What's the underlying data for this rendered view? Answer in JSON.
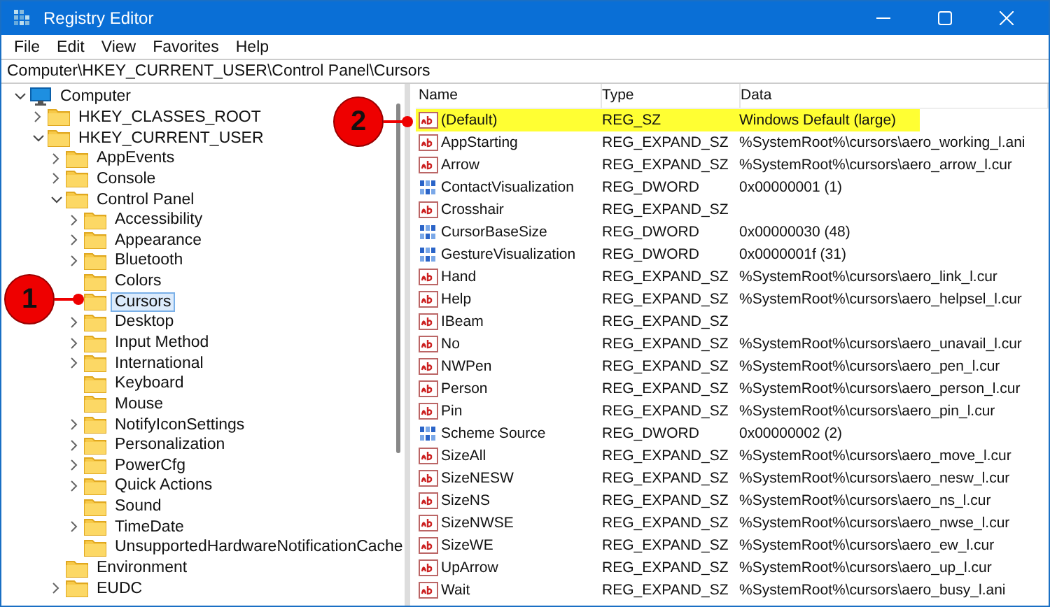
{
  "window": {
    "title": "Registry Editor"
  },
  "menu": [
    "File",
    "Edit",
    "View",
    "Favorites",
    "Help"
  ],
  "address": "Computer\\HKEY_CURRENT_USER\\Control Panel\\Cursors",
  "tree": [
    {
      "label": "Computer",
      "kind": "computer",
      "expanded": true,
      "selected": false,
      "children": [
        {
          "label": "HKEY_CLASSES_ROOT",
          "expanded": false,
          "selected": false
        },
        {
          "label": "HKEY_CURRENT_USER",
          "expanded": true,
          "selected": false,
          "children": [
            {
              "label": "AppEvents",
              "expanded": false,
              "selected": false
            },
            {
              "label": "Console",
              "expanded": false,
              "selected": false
            },
            {
              "label": "Control Panel",
              "expanded": true,
              "selected": false,
              "children": [
                {
                  "label": "Accessibility",
                  "expanded": false,
                  "selected": false
                },
                {
                  "label": "Appearance",
                  "expanded": false,
                  "selected": false
                },
                {
                  "label": "Bluetooth",
                  "expanded": false,
                  "selected": false
                },
                {
                  "label": "Colors",
                  "selected": false
                },
                {
                  "label": "Cursors",
                  "selected": true
                },
                {
                  "label": "Desktop",
                  "expanded": false,
                  "selected": false
                },
                {
                  "label": "Input Method",
                  "expanded": false,
                  "selected": false
                },
                {
                  "label": "International",
                  "expanded": false,
                  "selected": false
                },
                {
                  "label": "Keyboard",
                  "selected": false
                },
                {
                  "label": "Mouse",
                  "selected": false
                },
                {
                  "label": "NotifyIconSettings",
                  "expanded": false,
                  "selected": false
                },
                {
                  "label": "Personalization",
                  "expanded": false,
                  "selected": false
                },
                {
                  "label": "PowerCfg",
                  "expanded": false,
                  "selected": false
                },
                {
                  "label": "Quick Actions",
                  "expanded": false,
                  "selected": false
                },
                {
                  "label": "Sound",
                  "selected": false
                },
                {
                  "label": "TimeDate",
                  "expanded": false,
                  "selected": false
                },
                {
                  "label": "UnsupportedHardwareNotificationCache",
                  "selected": false
                }
              ]
            },
            {
              "label": "Environment",
              "selected": false
            },
            {
              "label": "EUDC",
              "expanded": false,
              "selected": false
            }
          ]
        }
      ]
    }
  ],
  "table": {
    "columns": [
      "Name",
      "Type",
      "Data"
    ],
    "rows": [
      {
        "kind": "string",
        "name": "(Default)",
        "type": "REG_SZ",
        "data": "Windows Default (large)",
        "highlighted": true
      },
      {
        "kind": "string",
        "name": "AppStarting",
        "type": "REG_EXPAND_SZ",
        "data": "%SystemRoot%\\cursors\\aero_working_l.ani",
        "highlighted": false
      },
      {
        "kind": "string",
        "name": "Arrow",
        "type": "REG_EXPAND_SZ",
        "data": "%SystemRoot%\\cursors\\aero_arrow_l.cur",
        "highlighted": false
      },
      {
        "kind": "dword",
        "name": "ContactVisualization",
        "type": "REG_DWORD",
        "data": "0x00000001 (1)",
        "highlighted": false
      },
      {
        "kind": "string",
        "name": "Crosshair",
        "type": "REG_EXPAND_SZ",
        "highlighted": false
      },
      {
        "kind": "dword",
        "name": "CursorBaseSize",
        "type": "REG_DWORD",
        "data": "0x00000030 (48)",
        "highlighted": false
      },
      {
        "kind": "dword",
        "name": "GestureVisualization",
        "type": "REG_DWORD",
        "data": "0x0000001f (31)",
        "highlighted": false
      },
      {
        "kind": "string",
        "name": "Hand",
        "type": "REG_EXPAND_SZ",
        "data": "%SystemRoot%\\cursors\\aero_link_l.cur",
        "highlighted": false
      },
      {
        "kind": "string",
        "name": "Help",
        "type": "REG_EXPAND_SZ",
        "data": "%SystemRoot%\\cursors\\aero_helpsel_l.cur",
        "highlighted": false
      },
      {
        "kind": "string",
        "name": "IBeam",
        "type": "REG_EXPAND_SZ",
        "highlighted": false
      },
      {
        "kind": "string",
        "name": "No",
        "type": "REG_EXPAND_SZ",
        "data": "%SystemRoot%\\cursors\\aero_unavail_l.cur",
        "highlighted": false
      },
      {
        "kind": "string",
        "name": "NWPen",
        "type": "REG_EXPAND_SZ",
        "data": "%SystemRoot%\\cursors\\aero_pen_l.cur",
        "highlighted": false
      },
      {
        "kind": "string",
        "name": "Person",
        "type": "REG_EXPAND_SZ",
        "data": "%SystemRoot%\\cursors\\aero_person_l.cur",
        "highlighted": false
      },
      {
        "kind": "string",
        "name": "Pin",
        "type": "REG_EXPAND_SZ",
        "data": "%SystemRoot%\\cursors\\aero_pin_l.cur",
        "highlighted": false
      },
      {
        "kind": "dword",
        "name": "Scheme Source",
        "type": "REG_DWORD",
        "data": "0x00000002 (2)",
        "highlighted": false
      },
      {
        "kind": "string",
        "name": "SizeAll",
        "type": "REG_EXPAND_SZ",
        "data": "%SystemRoot%\\cursors\\aero_move_l.cur",
        "highlighted": false
      },
      {
        "kind": "string",
        "name": "SizeNESW",
        "type": "REG_EXPAND_SZ",
        "data": "%SystemRoot%\\cursors\\aero_nesw_l.cur",
        "highlighted": false
      },
      {
        "kind": "string",
        "name": "SizeNS",
        "type": "REG_EXPAND_SZ",
        "data": "%SystemRoot%\\cursors\\aero_ns_l.cur",
        "highlighted": false
      },
      {
        "kind": "string",
        "name": "SizeNWSE",
        "type": "REG_EXPAND_SZ",
        "data": "%SystemRoot%\\cursors\\aero_nwse_l.cur",
        "highlighted": false
      },
      {
        "kind": "string",
        "name": "SizeWE",
        "type": "REG_EXPAND_SZ",
        "data": "%SystemRoot%\\cursors\\aero_ew_l.cur",
        "highlighted": false
      },
      {
        "kind": "string",
        "name": "UpArrow",
        "type": "REG_EXPAND_SZ",
        "data": "%SystemRoot%\\cursors\\aero_up_l.cur",
        "highlighted": false
      },
      {
        "kind": "string",
        "name": "Wait",
        "type": "REG_EXPAND_SZ",
        "data": "%SystemRoot%\\cursors\\aero_busy_l.ani",
        "highlighted": false
      }
    ]
  },
  "callouts": [
    "1",
    "2"
  ]
}
